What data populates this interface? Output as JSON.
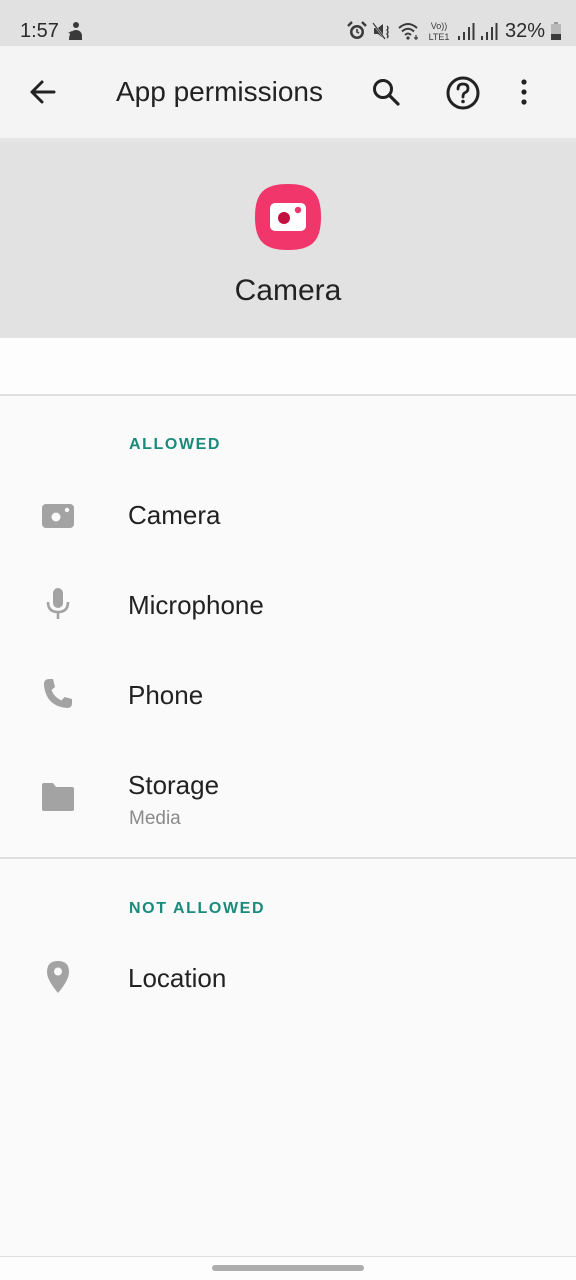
{
  "status_bar": {
    "time": "1:57",
    "notification_icon": "notification-person-icon",
    "icons": [
      "alarm-icon",
      "mute-icon",
      "wifi-icon",
      "volte-lte-icon",
      "signal-icon",
      "signal-icon"
    ],
    "volte_label_top": "Vo))",
    "volte_label_bottom": "LTE1",
    "battery_percent": "32%"
  },
  "toolbar": {
    "back_icon": "arrow-left-icon",
    "title": "App permissions",
    "search_icon": "search-icon",
    "help_icon": "help-circle-icon",
    "more_icon": "more-vert-icon"
  },
  "app_header": {
    "app_name": "Camera",
    "app_icon": "camera-app-icon",
    "icon_color": "#f0366b"
  },
  "colors": {
    "accent": "#1b8a7b",
    "icon_gray": "#a3a3a3",
    "header_bg": "#e2e2e2"
  },
  "sections": [
    {
      "label": "ALLOWED",
      "items": [
        {
          "label": "Camera",
          "icon": "camera-icon",
          "subtitle": ""
        },
        {
          "label": "Microphone",
          "icon": "microphone-icon",
          "subtitle": ""
        },
        {
          "label": "Phone",
          "icon": "phone-icon",
          "subtitle": ""
        },
        {
          "label": "Storage",
          "icon": "folder-icon",
          "subtitle": "Media"
        }
      ]
    },
    {
      "label": "NOT ALLOWED",
      "items": [
        {
          "label": "Location",
          "icon": "location-pin-icon",
          "subtitle": ""
        }
      ]
    }
  ]
}
